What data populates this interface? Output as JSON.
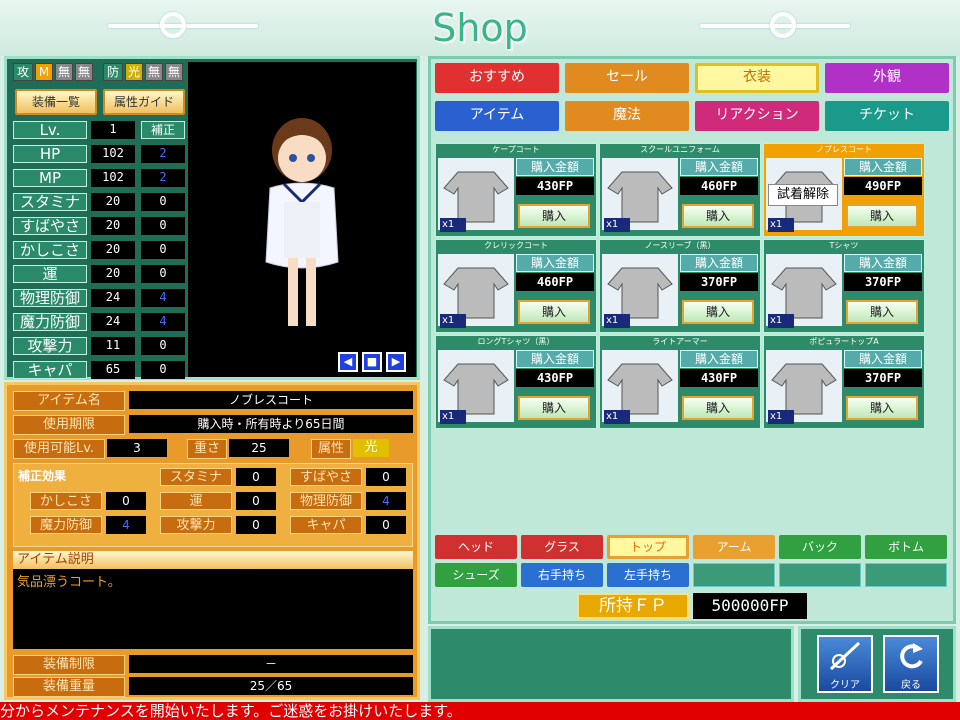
{
  "header": {
    "title": "Shop"
  },
  "equip_tags": {
    "atk_label": "攻",
    "atk_m": "M",
    "atk_none1": "無",
    "atk_none2": "無",
    "def_label": "防",
    "def_light": "光",
    "def_none1": "無",
    "def_none2": "無"
  },
  "buttons": {
    "equip_list": "装備一覧",
    "attr_guide": "属性ガイド"
  },
  "stats": {
    "header_bonus": "補正",
    "rows": [
      {
        "label": "Lv.",
        "value": "1",
        "bonus": ""
      },
      {
        "label": "HP",
        "value": "102",
        "bonus": "2"
      },
      {
        "label": "MP",
        "value": "102",
        "bonus": "2"
      },
      {
        "label": "スタミナ",
        "value": "20",
        "bonus": "0"
      },
      {
        "label": "すばやさ",
        "value": "20",
        "bonus": "0"
      },
      {
        "label": "かしこさ",
        "value": "20",
        "bonus": "0"
      },
      {
        "label": "運",
        "value": "20",
        "bonus": "0"
      },
      {
        "label": "物理防御",
        "value": "24",
        "bonus": "4"
      },
      {
        "label": "魔力防御",
        "value": "24",
        "bonus": "4"
      },
      {
        "label": "攻撃力",
        "value": "11",
        "bonus": "0"
      },
      {
        "label": "キャパ",
        "value": "65",
        "bonus": "0"
      }
    ]
  },
  "preview_controls": {
    "prev": "◀",
    "stop": "■",
    "next": "▶"
  },
  "item_info": {
    "name_label": "アイテム名",
    "name": "ノブレスコート",
    "period_label": "使用期限",
    "period": "購入時・所有時より65日間",
    "level_label": "使用可能Lv.",
    "level": "3",
    "weight_label": "重さ",
    "weight": "25",
    "attr_label": "属性",
    "attr": "光",
    "effects_label": "補正効果",
    "effects": [
      {
        "label": "スタミナ",
        "value": "0"
      },
      {
        "label": "すばやさ",
        "value": "0"
      },
      {
        "label": "かしこさ",
        "value": "0"
      },
      {
        "label": "運",
        "value": "0"
      },
      {
        "label": "物理防御",
        "value": "4"
      },
      {
        "label": "魔力防御",
        "value": "4"
      },
      {
        "label": "攻撃力",
        "value": "0"
      },
      {
        "label": "キャパ",
        "value": "0"
      }
    ],
    "desc_label": "アイテム説明",
    "desc": "気品漂うコート。",
    "restrict_label": "装備制限",
    "restrict": "－",
    "weight_total_label": "装備重量",
    "weight_total": "25／65"
  },
  "categories": [
    {
      "label": "おすすめ",
      "color": "#e03030"
    },
    {
      "label": "セール",
      "color": "#e08a20"
    },
    {
      "label": "衣装",
      "color": "#e0c020"
    },
    {
      "label": "外観",
      "color": "#b030c8"
    },
    {
      "label": "アイテム",
      "color": "#2a60d0"
    },
    {
      "label": "魔法",
      "color": "#e08a20"
    },
    {
      "label": "リアクション",
      "color": "#d02a7a"
    },
    {
      "label": "チケット",
      "color": "#1a9a8a"
    }
  ],
  "price_label": "購入金額",
  "buy_label": "購入",
  "tryon_label": "試着解除",
  "items": [
    {
      "name": "ケープコート",
      "price": "430FP",
      "qty": "x1",
      "icon": "cape-coat-icon"
    },
    {
      "name": "スクールユニフォーム",
      "price": "460FP",
      "qty": "x1",
      "icon": "school-uniform-icon"
    },
    {
      "name": "ノブレスコート",
      "price": "490FP",
      "qty": "x1",
      "icon": "noble-coat-icon"
    },
    {
      "name": "クレリックコート",
      "price": "460FP",
      "qty": "x1",
      "icon": "cleric-coat-icon"
    },
    {
      "name": "ノースリーブ（黒）",
      "price": "370FP",
      "qty": "x1",
      "icon": "sleeveless-icon"
    },
    {
      "name": "Tシャツ",
      "price": "370FP",
      "qty": "x1",
      "icon": "tshirt-icon"
    },
    {
      "name": "ロングTシャツ（黒）",
      "price": "430FP",
      "qty": "x1",
      "icon": "long-tshirt-icon"
    },
    {
      "name": "ライトアーマー",
      "price": "430FP",
      "qty": "x1",
      "icon": "light-armor-icon"
    },
    {
      "name": "ポピュラートップA",
      "price": "370FP",
      "qty": "x1",
      "icon": "popular-top-icon"
    }
  ],
  "slot_tabs": [
    {
      "label": "ヘッド",
      "color": "#d03030"
    },
    {
      "label": "グラス",
      "color": "#d03030"
    },
    {
      "label": "トップ",
      "color": "#e8a030"
    },
    {
      "label": "アーム",
      "color": "#e8a030"
    },
    {
      "label": "バック",
      "color": "#30a040"
    },
    {
      "label": "ボトム",
      "color": "#30a040"
    },
    {
      "label": "シューズ",
      "color": "#30a040"
    },
    {
      "label": "右手持ち",
      "color": "#2a70d0"
    },
    {
      "label": "左手持ち",
      "color": "#2a70d0"
    }
  ],
  "fp": {
    "label": "所持ＦＰ",
    "value": "500000FP"
  },
  "actions": {
    "clear": "クリア",
    "back": "戻る"
  },
  "ticker": "分からメンテナンスを開始いたします。ご迷惑をお掛けいたします。"
}
